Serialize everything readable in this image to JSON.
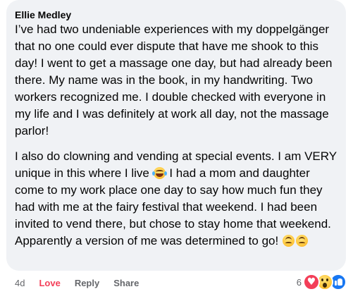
{
  "comment": {
    "author": "Ellie Medley",
    "paragraph1": "I’ve had two undeniable experiences with my doppelgänger that no one could ever dispute that have me shook to this day! I went to get a massage one day, but had already been there. My name was in the book, in my handwriting. Two workers recognized me. I double checked with everyone in my life and I was definitely at work all day, not the massage parlor!",
    "paragraph2_part1": "I also do clowning and vending at special events. I am VERY unique in this where I live",
    "paragraph2_part2": " I had a mom and daughter come to my work place one day to say how much fun they had with me at the fairy festival that weekend. I had been invited to vend there, but chose to stay home that weekend. Apparently a version of me was determined to go!",
    "emoji1": "laughing-crying-emoji",
    "emoji2": "upside-down-face-emoji"
  },
  "actions": {
    "time": "4d",
    "love_label": "Love",
    "reply_label": "Reply",
    "share_label": "Share"
  },
  "reactions": {
    "count": "6",
    "types": [
      "heart-reaction-icon",
      "wow-reaction-icon",
      "like-reaction-icon"
    ],
    "colors": {
      "love": "#f33e58",
      "like": "#1877f2"
    }
  },
  "colors": {
    "bubble_bg": "#f0f2f5",
    "text": "#050505",
    "secondary": "#65676b"
  }
}
